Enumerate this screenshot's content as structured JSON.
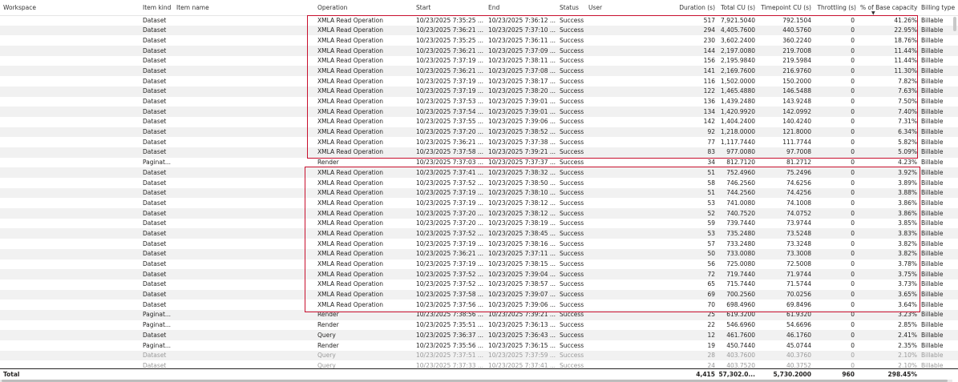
{
  "header": {
    "workspace": "Workspace",
    "item_kind": "Item kind",
    "item_name": "Item name",
    "operation": "Operation",
    "start": "Start",
    "end": "End",
    "status": "Status",
    "user": "User",
    "duration": "Duration (s)",
    "total_cu": "Total CU (s)",
    "timepoint_cu": "Timepoint CU (s)",
    "throttling": "Throttling (s)",
    "pct_base": "% of Base capacity",
    "billing": "Billing type",
    "sort_icon": "sort-descending-icon"
  },
  "rows": [
    {
      "kind": "Dataset",
      "op": "XMLA Read Operation",
      "start": "10/23/2025 7:35:25 ...",
      "end": "10/23/2025 7:36:12 ...",
      "status": "Success",
      "dur": "517",
      "tcu": "7,921.5040",
      "tpcu": "792.1504",
      "thr": "0",
      "pct": "41.26%",
      "bill": "Billable"
    },
    {
      "kind": "Dataset",
      "op": "XMLA Read Operation",
      "start": "10/23/2025 7:36:21 ...",
      "end": "10/23/2025 7:37:10 ...",
      "status": "Success",
      "dur": "294",
      "tcu": "4,405.7600",
      "tpcu": "440.5760",
      "thr": "0",
      "pct": "22.95%",
      "bill": "Billable"
    },
    {
      "kind": "Dataset",
      "op": "XMLA Read Operation",
      "start": "10/23/2025 7:35:25 ...",
      "end": "10/23/2025 7:36:11 ...",
      "status": "Success",
      "dur": "230",
      "tcu": "3,602.2400",
      "tpcu": "360.2240",
      "thr": "0",
      "pct": "18.76%",
      "bill": "Billable"
    },
    {
      "kind": "Dataset",
      "op": "XMLA Read Operation",
      "start": "10/23/2025 7:36:21 ...",
      "end": "10/23/2025 7:37:09 ...",
      "status": "Success",
      "dur": "144",
      "tcu": "2,197.0080",
      "tpcu": "219.7008",
      "thr": "0",
      "pct": "11.44%",
      "bill": "Billable"
    },
    {
      "kind": "Dataset",
      "op": "XMLA Read Operation",
      "start": "10/23/2025 7:37:19 ...",
      "end": "10/23/2025 7:38:11 ...",
      "status": "Success",
      "dur": "156",
      "tcu": "2,195.9840",
      "tpcu": "219.5984",
      "thr": "0",
      "pct": "11.44%",
      "bill": "Billable"
    },
    {
      "kind": "Dataset",
      "op": "XMLA Read Operation",
      "start": "10/23/2025 7:36:21 ...",
      "end": "10/23/2025 7:37:08 ...",
      "status": "Success",
      "dur": "141",
      "tcu": "2,169.7600",
      "tpcu": "216.9760",
      "thr": "0",
      "pct": "11.30%",
      "bill": "Billable"
    },
    {
      "kind": "Dataset",
      "op": "XMLA Read Operation",
      "start": "10/23/2025 7:37:19 ...",
      "end": "10/23/2025 7:38:17 ...",
      "status": "Success",
      "dur": "116",
      "tcu": "1,502.0000",
      "tpcu": "150.2000",
      "thr": "0",
      "pct": "7.82%",
      "bill": "Billable"
    },
    {
      "kind": "Dataset",
      "op": "XMLA Read Operation",
      "start": "10/23/2025 7:37:19 ...",
      "end": "10/23/2025 7:38:20 ...",
      "status": "Success",
      "dur": "122",
      "tcu": "1,465.4880",
      "tpcu": "146.5488",
      "thr": "0",
      "pct": "7.63%",
      "bill": "Billable"
    },
    {
      "kind": "Dataset",
      "op": "XMLA Read Operation",
      "start": "10/23/2025 7:37:53 ...",
      "end": "10/23/2025 7:39:01 ...",
      "status": "Success",
      "dur": "136",
      "tcu": "1,439.2480",
      "tpcu": "143.9248",
      "thr": "0",
      "pct": "7.50%",
      "bill": "Billable"
    },
    {
      "kind": "Dataset",
      "op": "XMLA Read Operation",
      "start": "10/23/2025 7:37:54 ...",
      "end": "10/23/2025 7:39:01 ...",
      "status": "Success",
      "dur": "134",
      "tcu": "1,420.9920",
      "tpcu": "142.0992",
      "thr": "0",
      "pct": "7.40%",
      "bill": "Billable"
    },
    {
      "kind": "Dataset",
      "op": "XMLA Read Operation",
      "start": "10/23/2025 7:37:55 ...",
      "end": "10/23/2025 7:39:06 ...",
      "status": "Success",
      "dur": "142",
      "tcu": "1,404.2400",
      "tpcu": "140.4240",
      "thr": "0",
      "pct": "7.31%",
      "bill": "Billable"
    },
    {
      "kind": "Dataset",
      "op": "XMLA Read Operation",
      "start": "10/23/2025 7:37:20 ...",
      "end": "10/23/2025 7:38:52 ...",
      "status": "Success",
      "dur": "92",
      "tcu": "1,218.0000",
      "tpcu": "121.8000",
      "thr": "0",
      "pct": "6.34%",
      "bill": "Billable"
    },
    {
      "kind": "Dataset",
      "op": "XMLA Read Operation",
      "start": "10/23/2025 7:36:21 ...",
      "end": "10/23/2025 7:37:38 ...",
      "status": "Success",
      "dur": "77",
      "tcu": "1,117.7440",
      "tpcu": "111.7744",
      "thr": "0",
      "pct": "5.82%",
      "bill": "Billable"
    },
    {
      "kind": "Dataset",
      "op": "XMLA Read Operation",
      "start": "10/23/2025 7:37:58 ...",
      "end": "10/23/2025 7:39:21 ...",
      "status": "Success",
      "dur": "83",
      "tcu": "977.0080",
      "tpcu": "97.7008",
      "thr": "0",
      "pct": "5.09%",
      "bill": "Billable"
    },
    {
      "kind": "Paginat...",
      "op": "Render",
      "start": "10/23/2025 7:37:03 ...",
      "end": "10/23/2025 7:37:37 ...",
      "status": "Success",
      "dur": "34",
      "tcu": "812.7120",
      "tpcu": "81.2712",
      "thr": "0",
      "pct": "4.23%",
      "bill": "Billable"
    },
    {
      "kind": "Dataset",
      "op": "XMLA Read Operation",
      "start": "10/23/2025 7:37:41 ...",
      "end": "10/23/2025 7:38:32 ...",
      "status": "Success",
      "dur": "51",
      "tcu": "752.4960",
      "tpcu": "75.2496",
      "thr": "0",
      "pct": "3.92%",
      "bill": "Billable"
    },
    {
      "kind": "Dataset",
      "op": "XMLA Read Operation",
      "start": "10/23/2025 7:37:52 ...",
      "end": "10/23/2025 7:38:50 ...",
      "status": "Success",
      "dur": "58",
      "tcu": "746.2560",
      "tpcu": "74.6256",
      "thr": "0",
      "pct": "3.89%",
      "bill": "Billable"
    },
    {
      "kind": "Dataset",
      "op": "XMLA Read Operation",
      "start": "10/23/2025 7:37:19 ...",
      "end": "10/23/2025 7:38:10 ...",
      "status": "Success",
      "dur": "51",
      "tcu": "744.2560",
      "tpcu": "74.4256",
      "thr": "0",
      "pct": "3.88%",
      "bill": "Billable"
    },
    {
      "kind": "Dataset",
      "op": "XMLA Read Operation",
      "start": "10/23/2025 7:37:19 ...",
      "end": "10/23/2025 7:38:12 ...",
      "status": "Success",
      "dur": "53",
      "tcu": "741.0080",
      "tpcu": "74.1008",
      "thr": "0",
      "pct": "3.86%",
      "bill": "Billable"
    },
    {
      "kind": "Dataset",
      "op": "XMLA Read Operation",
      "start": "10/23/2025 7:37:20 ...",
      "end": "10/23/2025 7:38:12 ...",
      "status": "Success",
      "dur": "52",
      "tcu": "740.7520",
      "tpcu": "74.0752",
      "thr": "0",
      "pct": "3.86%",
      "bill": "Billable"
    },
    {
      "kind": "Dataset",
      "op": "XMLA Read Operation",
      "start": "10/23/2025 7:37:20 ...",
      "end": "10/23/2025 7:38:19 ...",
      "status": "Success",
      "dur": "59",
      "tcu": "739.7440",
      "tpcu": "73.9744",
      "thr": "0",
      "pct": "3.85%",
      "bill": "Billable"
    },
    {
      "kind": "Dataset",
      "op": "XMLA Read Operation",
      "start": "10/23/2025 7:37:52 ...",
      "end": "10/23/2025 7:38:45 ...",
      "status": "Success",
      "dur": "53",
      "tcu": "735.2480",
      "tpcu": "73.5248",
      "thr": "0",
      "pct": "3.83%",
      "bill": "Billable"
    },
    {
      "kind": "Dataset",
      "op": "XMLA Read Operation",
      "start": "10/23/2025 7:37:19 ...",
      "end": "10/23/2025 7:38:16 ...",
      "status": "Success",
      "dur": "57",
      "tcu": "733.2480",
      "tpcu": "73.3248",
      "thr": "0",
      "pct": "3.82%",
      "bill": "Billable"
    },
    {
      "kind": "Dataset",
      "op": "XMLA Read Operation",
      "start": "10/23/2025 7:36:21 ...",
      "end": "10/23/2025 7:37:11 ...",
      "status": "Success",
      "dur": "50",
      "tcu": "733.0080",
      "tpcu": "73.3008",
      "thr": "0",
      "pct": "3.82%",
      "bill": "Billable"
    },
    {
      "kind": "Dataset",
      "op": "XMLA Read Operation",
      "start": "10/23/2025 7:37:19 ...",
      "end": "10/23/2025 7:38:15 ...",
      "status": "Success",
      "dur": "56",
      "tcu": "725.0080",
      "tpcu": "72.5008",
      "thr": "0",
      "pct": "3.78%",
      "bill": "Billable"
    },
    {
      "kind": "Dataset",
      "op": "XMLA Read Operation",
      "start": "10/23/2025 7:37:52 ...",
      "end": "10/23/2025 7:39:04 ...",
      "status": "Success",
      "dur": "72",
      "tcu": "719.7440",
      "tpcu": "71.9744",
      "thr": "0",
      "pct": "3.75%",
      "bill": "Billable"
    },
    {
      "kind": "Dataset",
      "op": "XMLA Read Operation",
      "start": "10/23/2025 7:37:52 ...",
      "end": "10/23/2025 7:38:57 ...",
      "status": "Success",
      "dur": "65",
      "tcu": "715.7440",
      "tpcu": "71.5744",
      "thr": "0",
      "pct": "3.73%",
      "bill": "Billable"
    },
    {
      "kind": "Dataset",
      "op": "XMLA Read Operation",
      "start": "10/23/2025 7:37:58 ...",
      "end": "10/23/2025 7:39:07 ...",
      "status": "Success",
      "dur": "69",
      "tcu": "700.2560",
      "tpcu": "70.0256",
      "thr": "0",
      "pct": "3.65%",
      "bill": "Billable"
    },
    {
      "kind": "Dataset",
      "op": "XMLA Read Operation",
      "start": "10/23/2025 7:37:56 ...",
      "end": "10/23/2025 7:39:06 ...",
      "status": "Success",
      "dur": "70",
      "tcu": "698.4960",
      "tpcu": "69.8496",
      "thr": "0",
      "pct": "3.64%",
      "bill": "Billable"
    },
    {
      "kind": "Paginat...",
      "op": "Render",
      "start": "10/23/2025 7:38:56 ...",
      "end": "10/23/2025 7:39:21 ...",
      "status": "Success",
      "dur": "25",
      "tcu": "619.3200",
      "tpcu": "61.9320",
      "thr": "0",
      "pct": "3.23%",
      "bill": "Billable"
    },
    {
      "kind": "Paginat...",
      "op": "Render",
      "start": "10/23/2025 7:35:51 ...",
      "end": "10/23/2025 7:36:13 ...",
      "status": "Success",
      "dur": "22",
      "tcu": "546.6960",
      "tpcu": "54.6696",
      "thr": "0",
      "pct": "2.85%",
      "bill": "Billable"
    },
    {
      "kind": "Dataset",
      "op": "Query",
      "start": "10/23/2025 7:36:37 ...",
      "end": "10/23/2025 7:36:43 ...",
      "status": "Success",
      "dur": "12",
      "tcu": "461.7600",
      "tpcu": "46.1760",
      "thr": "0",
      "pct": "2.41%",
      "bill": "Billable"
    },
    {
      "kind": "Paginat...",
      "op": "Render",
      "start": "10/23/2025 7:35:56 ...",
      "end": "10/23/2025 7:36:15 ...",
      "status": "Success",
      "dur": "19",
      "tcu": "450.7440",
      "tpcu": "45.0744",
      "thr": "0",
      "pct": "2.35%",
      "bill": "Billable"
    },
    {
      "kind": "Dataset",
      "op": "Query",
      "start": "10/23/2025 7:37:51 ...",
      "end": "10/23/2025 7:37:59 ...",
      "status": "Success",
      "dur": "28",
      "tcu": "403.7600",
      "tpcu": "40.3760",
      "thr": "0",
      "pct": "2.10%",
      "bill": "Billable"
    },
    {
      "kind": "Dataset",
      "op": "Query",
      "start": "10/23/2025 7:37:33 ...",
      "end": "10/23/2025 7:37:41 ...",
      "status": "Success",
      "dur": "24",
      "tcu": "403.7520",
      "tpcu": "40.3752",
      "thr": "0",
      "pct": "2.10%",
      "bill": "Billable"
    }
  ],
  "total": {
    "label": "Total",
    "dur": "4,415",
    "tcu": "57,302.0...",
    "tpcu": "5,730.2000",
    "thr": "960",
    "pct": "298.45%"
  },
  "colors": {
    "highlight_border": "#c8102e",
    "alt_row": "#f1f1f1",
    "text": "#252423"
  }
}
